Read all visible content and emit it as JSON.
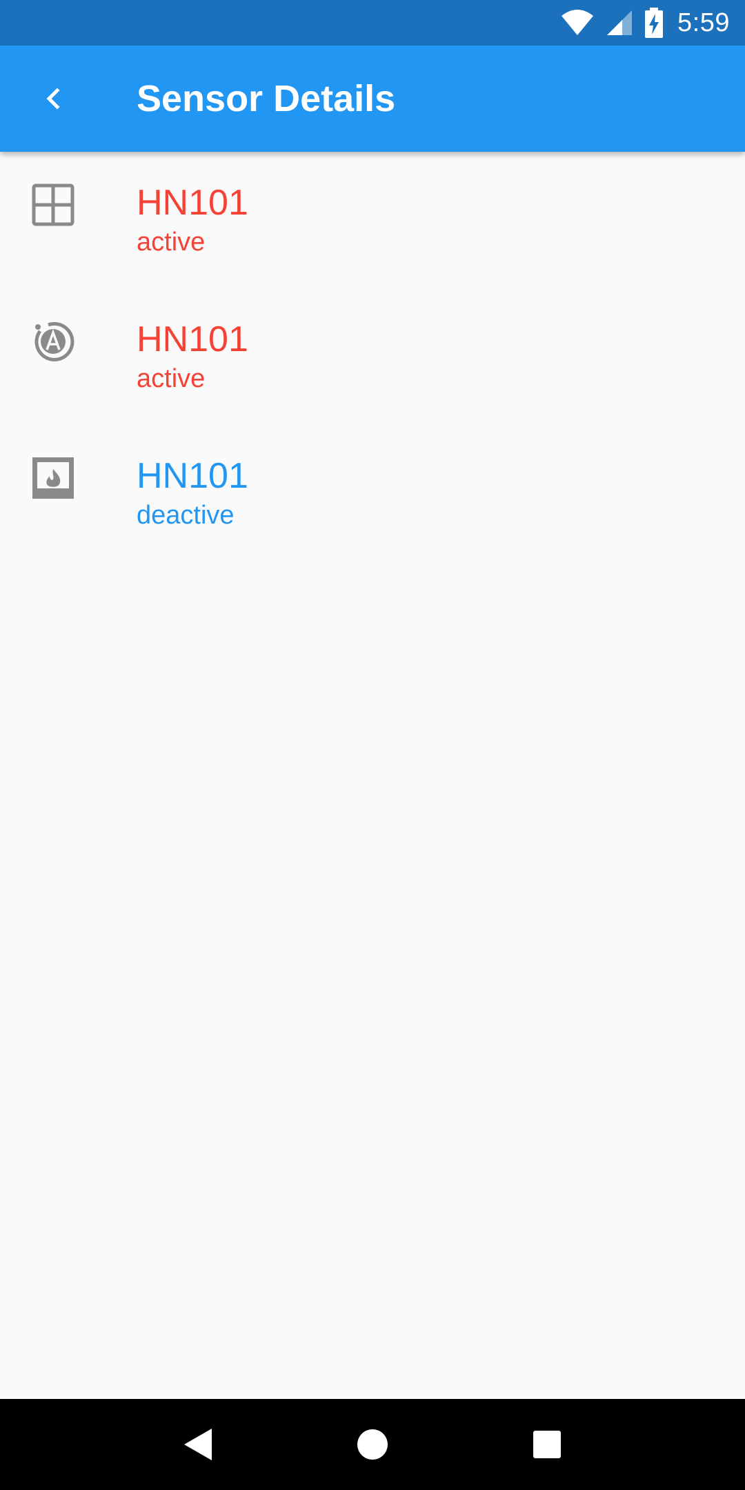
{
  "status_bar": {
    "time": "5:59",
    "icons": [
      "wifi-icon",
      "cell-signal-icon",
      "battery-charging-icon"
    ]
  },
  "app_bar": {
    "title": "Sensor Details",
    "back_icon": "chevron-left-icon"
  },
  "colors": {
    "active": "#f44336",
    "inactive": "#2196f3",
    "app_bar": "#2196f3",
    "status_bar": "#1b71bb",
    "icon_gray": "#8a8a8a"
  },
  "sensors": [
    {
      "name": "HN101",
      "status": "active",
      "icon": "window-icon",
      "color": "#f44336"
    },
    {
      "name": "HN101",
      "status": "active",
      "icon": "auto-mode-icon",
      "color": "#f44336"
    },
    {
      "name": "HN101",
      "status": "deactive",
      "icon": "fireplace-icon",
      "color": "#2196f3"
    }
  ],
  "nav_bar": {
    "icons": [
      "back-triangle-icon",
      "home-circle-icon",
      "recents-square-icon"
    ]
  }
}
